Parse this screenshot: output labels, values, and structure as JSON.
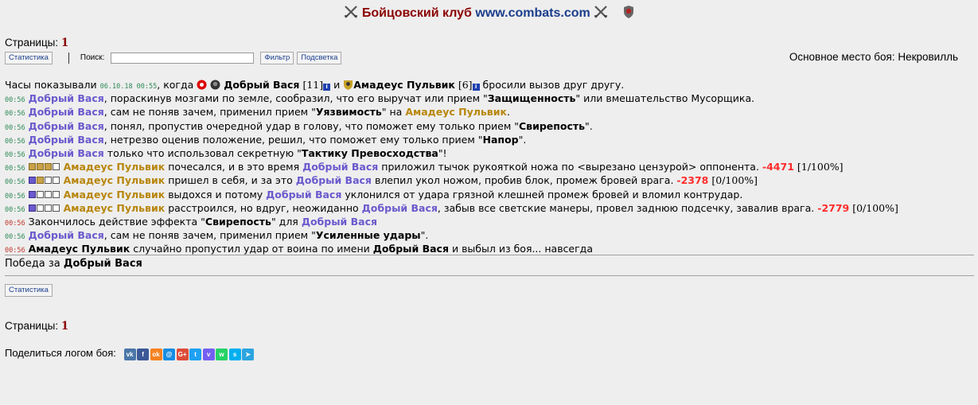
{
  "header": {
    "title_ru": "Бойцовский клуб",
    "title_url": "www.combats.com",
    "colors": {
      "title": "#8b0000",
      "url": "#1a3e8c"
    }
  },
  "pages": {
    "label": "Страницы:",
    "current": "1"
  },
  "toolbar": {
    "stats_btn": "Статистика",
    "search_label": "Поиск:",
    "search_value": "",
    "filter_btn": "Фильтр",
    "highlight_btn": "Подсветка",
    "place": "Основное место боя: Некровилль"
  },
  "log": {
    "intro": {
      "pre": "Часы показывали",
      "time": "06.10.18 00:55",
      "when": ", когда",
      "p1": "Добрый Вася",
      "p1lvl": "[11]",
      "and": "и",
      "p2": "Амадеус Пульвик",
      "p2lvl": "[6]",
      "post": "бросили вызов друг другу."
    },
    "l2": {
      "ts": "00:56",
      "who": "Добрый Вася",
      "a": ", пораскинув мозгами по земле, сообразил, что его выручат или прием \"",
      "skill": "Защищенность",
      "b": "\" или вмешательство Мусорщика."
    },
    "l3": {
      "ts": "00:56",
      "who": "Добрый Вася",
      "a": ", сам не поняв зачем, применил прием \"",
      "skill": "Уязвимость",
      "b": "\" на",
      "target": "Амадеус Пульвик",
      "c": "."
    },
    "l4": {
      "ts": "00:56",
      "who": "Добрый Вася",
      "a": ", понял, пропустив очередной удар в голову, что поможет ему только прием \"",
      "skill": "Свирепость",
      "b": "\"."
    },
    "l5": {
      "ts": "00:56",
      "who": "Добрый Вася",
      "a": ", нетрезво оценив положение, решил, что поможет ему только прием \"",
      "skill": "Напор",
      "b": "\"."
    },
    "l6": {
      "ts": "00:56",
      "who": "Добрый Вася",
      "a": "только что использовал секретную \"",
      "skill": "Тактику Превосходства",
      "b": "\"!"
    },
    "l7": {
      "ts": "00:56",
      "who": "Амадеус Пульвик",
      "a": "почесался, и в это время",
      "attacker": "Добрый Вася",
      "b": "приложил тычок рукояткой ножа по <вырезано цензурой> оппонента.",
      "dmg": "-4471",
      "hp": "[1/100%]"
    },
    "l8": {
      "ts": "00:56",
      "who": "Амадеус Пульвик",
      "a": "пришел в себя, и за это",
      "attacker": "Добрый Вася",
      "b": "влепил укол ножом, пробив блок, промеж бровей врага.",
      "dmg": "-2378",
      "hp": "[0/100%]"
    },
    "l9": {
      "ts": "00:56",
      "who": "Амадеус Пульвик",
      "a": "выдохся и потому",
      "attacker": "Добрый Вася",
      "b": "уклонился от удара грязной клешней промеж бровей и вломил контрудар."
    },
    "l10": {
      "ts": "00:56",
      "who": "Амадеус Пульвик",
      "a": "расстроился, но вдруг, неожиданно",
      "attacker": "Добрый Вася",
      "b": ", забыв все светские манеры, провел заднюю подсечку, завалив врага.",
      "dmg": "-2779",
      "hp": "[0/100%]"
    },
    "l11": {
      "ts": "00:56",
      "a": "Закончилось действие эффекта \"",
      "skill": "Свирепость",
      "b": "\" для",
      "who": "Добрый Вася"
    },
    "l12": {
      "ts": "00:56",
      "who": "Добрый Вася",
      "a": ", сам не поняв зачем, применил прием \"",
      "skill": "Усиленные удары",
      "b": "\"."
    },
    "l13": {
      "ts": "00:56",
      "who": "Амадеус Пульвик",
      "a": "случайно пропустил удар от воина по имени",
      "attacker": "Добрый Вася",
      "b": "и выбыл из боя... навсегда"
    }
  },
  "victory": {
    "pre": "Победа за",
    "who": "Добрый Вася"
  },
  "bottom": {
    "stats_btn": "Статистика",
    "pages_label": "Страницы:",
    "pages_current": "1"
  },
  "share": {
    "label": "Поделиться логом боя:",
    "icons": [
      {
        "name": "vk-icon",
        "glyph": "vk",
        "color": "#4a76a8"
      },
      {
        "name": "facebook-icon",
        "glyph": "f",
        "color": "#3b5998"
      },
      {
        "name": "odnoklassniki-icon",
        "glyph": "ok",
        "color": "#f58220"
      },
      {
        "name": "mailru-icon",
        "glyph": "@",
        "color": "#168de2"
      },
      {
        "name": "googleplus-icon",
        "glyph": "G+",
        "color": "#dd4b39"
      },
      {
        "name": "twitter-icon",
        "glyph": "t",
        "color": "#1da1f2"
      },
      {
        "name": "viber-icon",
        "glyph": "v",
        "color": "#7360f2"
      },
      {
        "name": "whatsapp-icon",
        "glyph": "w",
        "color": "#25d366"
      },
      {
        "name": "skype-icon",
        "glyph": "s",
        "color": "#00aff0"
      },
      {
        "name": "telegram-icon",
        "glyph": "➤",
        "color": "#2ca5e0"
      }
    ]
  }
}
